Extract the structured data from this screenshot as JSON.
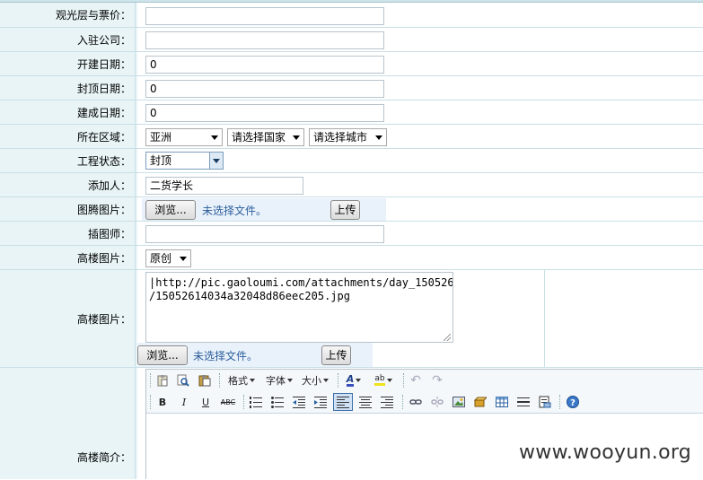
{
  "labels": {
    "observation": "观光层与票价：",
    "company": "入驻公司：",
    "start_date": "开建日期：",
    "topping_date": "封顶日期：",
    "complete_date": "建成日期：",
    "region": "所在区域：",
    "status": "工程状态：",
    "added_by": "添加人：",
    "totem_image": "图腾图片：",
    "illustrator": "插图师：",
    "building_image_select": "高楼图片：",
    "building_image": "高楼图片：",
    "intro": "高楼简介："
  },
  "values": {
    "observation": "",
    "company": "",
    "start_date": "0",
    "topping_date": "0",
    "complete_date": "0",
    "continent": "亚洲",
    "country": "请选择国家",
    "city": "请选择城市",
    "status": "封顶",
    "added_by": "二货学长",
    "illustrator": "",
    "image_source": "原创",
    "image_url": "|http://pic.gaoloumi.com/attachments/day_150526\n/15052614034a32048d86eec205.jpg"
  },
  "file": {
    "browse": "浏览...",
    "no_file": "未选择文件。",
    "upload": "上传"
  },
  "editor": {
    "format": "格式",
    "font": "字体",
    "size": "大小",
    "bold": "B",
    "italic": "I",
    "underline": "U",
    "strike": "ABC",
    "font_color_icon": "A",
    "highlight_icon": "ab"
  },
  "watermark": "www.wooyun.org"
}
